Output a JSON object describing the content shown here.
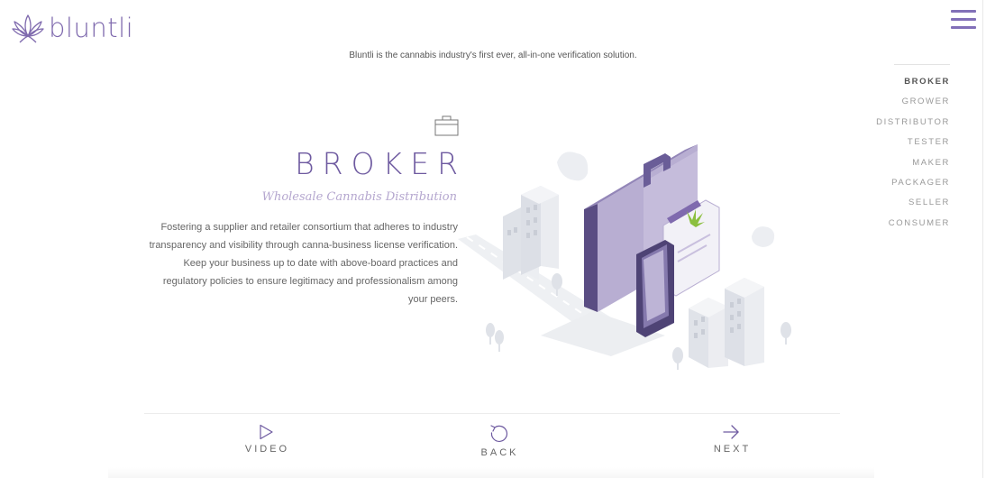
{
  "brand": {
    "name": "bluntli"
  },
  "tagline": "Bluntli is the cannabis industry's first ever, all-in-one verification solution.",
  "side_nav": {
    "items": [
      {
        "label": "BROKER",
        "active": true
      },
      {
        "label": "GROWER"
      },
      {
        "label": "DISTRIBUTOR"
      },
      {
        "label": "TESTER"
      },
      {
        "label": "MAKER"
      },
      {
        "label": "PACKAGER"
      },
      {
        "label": "SELLER"
      },
      {
        "label": "CONSUMER"
      }
    ]
  },
  "section": {
    "icon": "briefcase-icon",
    "title": "BROKER",
    "subtitle": "Wholesale Cannabis Distribution",
    "description": "Fostering a supplier and retailer consortium that adheres to industry transparency and visibility through canna-business license verification. Keep your business up to date with above-board practices and regulatory policies to ensure legitimacy and professionalism among your peers."
  },
  "controls": {
    "video": {
      "label": "VIDEO",
      "icon": "play-icon"
    },
    "back": {
      "label": "BACK",
      "icon": "undo-icon"
    },
    "next": {
      "label": "NEXT",
      "icon": "arrow-right-icon"
    }
  },
  "colors": {
    "accent": "#7f6aae",
    "title": "#6e5aa0",
    "subtitle": "#b5a7cf",
    "leaf": "#8bbf3f"
  }
}
